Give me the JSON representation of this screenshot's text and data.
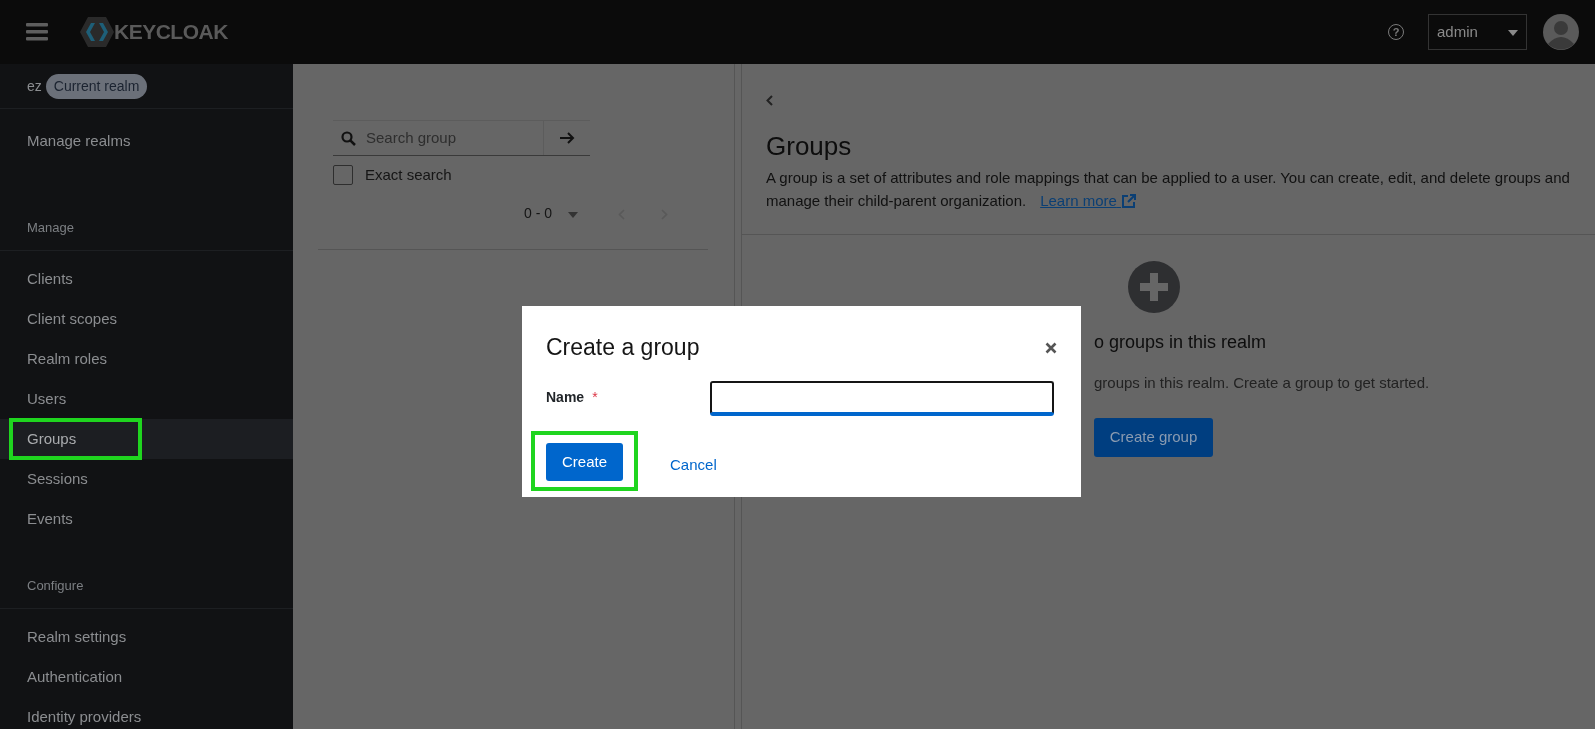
{
  "header": {
    "brand": "KEYCLOAK",
    "help": "?",
    "user": "admin"
  },
  "sidebar": {
    "realm": "ez",
    "realm_badge": "Current realm",
    "sections": [
      {
        "items": [
          {
            "label": "Manage realms",
            "selected": false,
            "highlighted": false
          }
        ]
      },
      {
        "heading": "Manage",
        "items": [
          {
            "label": "Clients",
            "selected": false,
            "highlighted": false
          },
          {
            "label": "Client scopes",
            "selected": false,
            "highlighted": false
          },
          {
            "label": "Realm roles",
            "selected": false,
            "highlighted": false
          },
          {
            "label": "Users",
            "selected": false,
            "highlighted": false
          },
          {
            "label": "Groups",
            "selected": true,
            "highlighted": true
          },
          {
            "label": "Sessions",
            "selected": false,
            "highlighted": false
          },
          {
            "label": "Events",
            "selected": false,
            "highlighted": false
          }
        ]
      },
      {
        "heading": "Configure",
        "items": [
          {
            "label": "Realm settings",
            "selected": false,
            "highlighted": false
          },
          {
            "label": "Authentication",
            "selected": false,
            "highlighted": false
          },
          {
            "label": "Identity providers",
            "selected": false,
            "highlighted": false
          }
        ]
      }
    ]
  },
  "tree_panel": {
    "search": {
      "placeholder": "Search group"
    },
    "exact_search": {
      "label": "Exact search",
      "checked": false
    },
    "pagination": "0 - 0"
  },
  "groups_panel": {
    "title": "Groups",
    "description": "A group is a set of attributes and role mappings that can be applied to a user. You can create, edit, and delete groups and manage their child-parent organization.",
    "learn_more": "Learn more",
    "empty_state": {
      "title": "o groups in this realm",
      "text": "groups in this realm. Create a group to get started.",
      "button": "Create group"
    }
  },
  "modal": {
    "title": "Create a group",
    "field": {
      "label": "Name",
      "required_mark": "*",
      "focused": true
    },
    "buttons": [
      {
        "kind": "primary",
        "label": "Create",
        "highlighted": true
      },
      {
        "kind": "link",
        "label": "Cancel",
        "highlighted": false
      }
    ]
  }
}
